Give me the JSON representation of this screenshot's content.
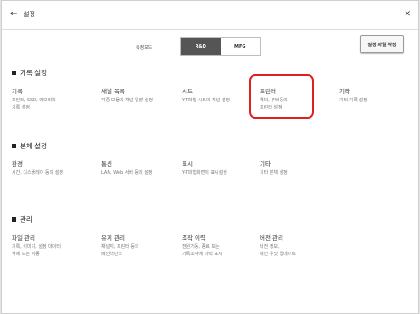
{
  "titlebar": {
    "back_icon": "←",
    "title": "설정",
    "close_icon": "✕"
  },
  "mode": {
    "label": "측정모드",
    "options": [
      "R&D",
      "MFG"
    ],
    "selected": "R&D"
  },
  "file_button": "설정 파일 작성",
  "sections": [
    {
      "title": "기록 설정",
      "items": [
        {
          "label": "기록",
          "desc": [
            "프린터, SSD, 메모리의",
            "기록 설정"
          ]
        },
        {
          "label": "채널 목록",
          "desc": [
            "각종 모듈의 채널 일괄 설정"
          ]
        },
        {
          "label": "시트",
          "desc": [
            "Y-T파형 시트의 채널 설정"
          ]
        },
        {
          "label": "프린터",
          "desc": [
            "헤더, 푸터등의",
            "프린터 설정"
          ]
        },
        {
          "label": "기타",
          "desc": [
            "기타 기록 설정"
          ]
        }
      ]
    },
    {
      "title": "본체 설정",
      "items": [
        {
          "label": "환경",
          "desc": [
            "시간, 디스플레이 등의 설정"
          ]
        },
        {
          "label": "통신",
          "desc": [
            "LAN, Web 서버 등의 설정"
          ]
        },
        {
          "label": "표시",
          "desc": [
            "Y-T파형화면의 표시설정"
          ]
        },
        {
          "label": "기타",
          "desc": [
            "기타 본체 설정"
          ]
        }
      ]
    },
    {
      "title": "관리",
      "items": [
        {
          "label": "파일 관리",
          "desc": [
            "기록, 이미지, 설정 데이터",
            "삭제 또는 이동"
          ]
        },
        {
          "label": "유지 관리",
          "desc": [
            "채널지, 프린터 등의",
            "메인터넌스"
          ]
        },
        {
          "label": "조작 이력",
          "desc": [
            "전원기동, 종료 또는",
            "기록조작에 이력 표시"
          ]
        },
        {
          "label": "버전 관리",
          "desc": [
            "버전 정보,",
            "메인 유닛 업데이트"
          ]
        }
      ]
    }
  ],
  "highlight_color": "#e02020"
}
